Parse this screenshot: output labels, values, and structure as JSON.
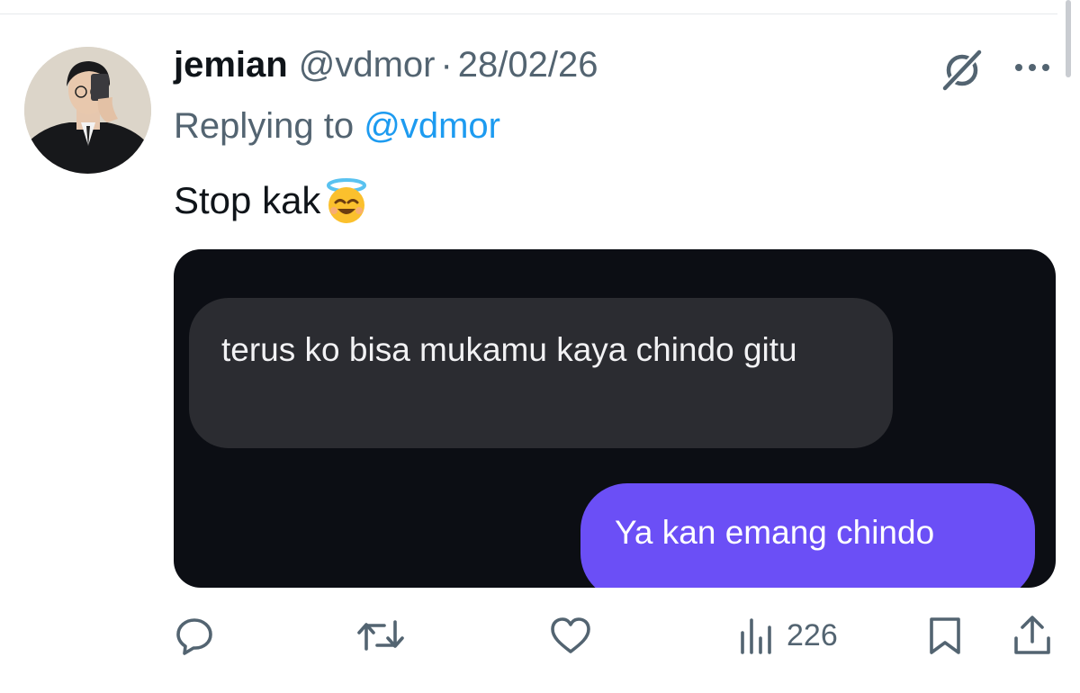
{
  "tweet": {
    "author_name": "jemian",
    "author_handle": "@vdmor",
    "separator": "·",
    "date": "28/02/26",
    "replying_prefix": "Replying to",
    "replying_handle": "@vdmor",
    "text": "Stop kak",
    "emoji": "smiling-face-with-halo"
  },
  "media": {
    "incoming_message": "terus ko bisa mukamu kaya chindo gitu",
    "outgoing_message": "Ya kan emang chindo"
  },
  "actions": {
    "reply": "reply-icon",
    "retweet": "retweet-icon",
    "like": "heart-icon",
    "views_count": "226",
    "bookmark": "bookmark-icon",
    "share": "share-icon"
  },
  "colors": {
    "text": "#0f1419",
    "secondary": "#536471",
    "link": "#1d9bf0",
    "media_bg": "#0c0e14",
    "bubble_in": "#2b2c31",
    "bubble_out": "#6b4ff6"
  }
}
